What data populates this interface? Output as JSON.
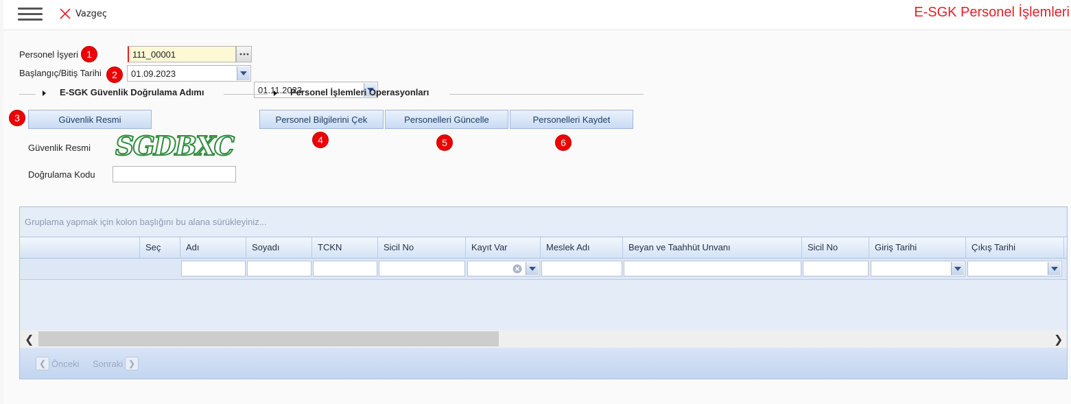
{
  "toolbar": {
    "cancel_label": "Vazgeç",
    "page_title": "E-SGK Personel İşlemleri"
  },
  "form": {
    "workplace_label": "Personel İşyeri",
    "workplace_value": "111_00001",
    "date_label": "Başlangıç/Bitiş Tarihi",
    "start_date": "01.09.2023",
    "end_date": "01.11.2023"
  },
  "badges": [
    "1",
    "2",
    "3",
    "4",
    "5",
    "6"
  ],
  "sections": {
    "security": "E-SGK Güvenlik Doğrulama Adımı",
    "operations": "Personel İşlemleri Operasyonları"
  },
  "buttons": {
    "security_image": "Güvenlik Resmi",
    "fetch": "Personel Bilgilerini Çek",
    "update": "Personelleri Güncelle",
    "save": "Personelleri Kaydet"
  },
  "security": {
    "image_label": "Güvenlik Resmi",
    "captcha_text": "SGDBXC",
    "code_label": "Doğrulama Kodu",
    "code_value": ""
  },
  "grid": {
    "group_hint": "Gruplama yapmak için kolon başlığını bu alana sürükleyiniz...",
    "columns": [
      "Seç",
      "Adı",
      "Soyadı",
      "TCKN",
      "Sicil No",
      "Kayıt Var",
      "Meslek Adı",
      "Beyan ve Taahhüt Unvanı",
      "Sicil No",
      "Giriş Tarihi",
      "Çıkış Tarihi"
    ],
    "prev_label": "Önceki",
    "next_label": "Sonraki"
  },
  "colors": {
    "title_red": "#e31e24",
    "badge_red": "#ee0000",
    "accent_blue": "#30558f"
  },
  "icons": [
    "menu-icon",
    "close-x-icon",
    "ellipsis-icon",
    "chevron-down-icon",
    "caret-right-icon",
    "clear-circle-icon",
    "arrow-left-icon",
    "arrow-right-icon"
  ]
}
